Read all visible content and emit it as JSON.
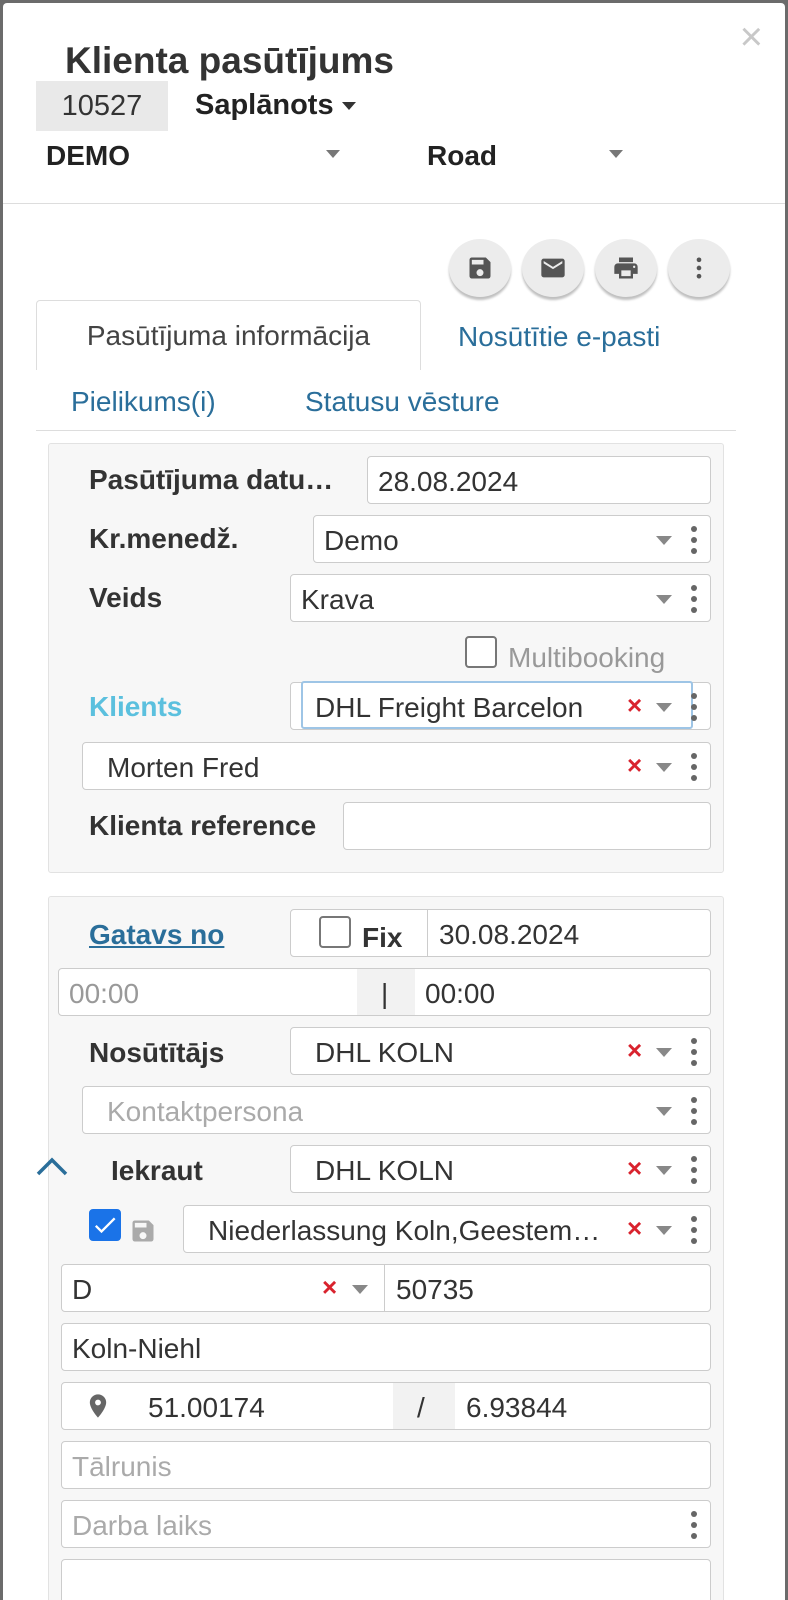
{
  "header": {
    "title": "Klienta pasūtījums",
    "order_number": "10527",
    "status": "Saplānots",
    "company": "DEMO",
    "transport": "Road"
  },
  "toolbar": {
    "save": "save-icon",
    "email": "envelope-icon",
    "print": "printer-icon",
    "more": "more-vertical-icon"
  },
  "tabs": [
    {
      "label": "Pasūtījuma informācija",
      "active": true
    },
    {
      "label": "Nosūtītie e-pasti",
      "active": false
    },
    {
      "label": "Pielikums(i)",
      "active": false
    },
    {
      "label": "Statusu vēsture",
      "active": false
    }
  ],
  "order_info": {
    "order_date_label": "Pasūtījuma datu…",
    "order_date": "28.08.2024",
    "manager_label": "Kr.menedž.",
    "manager": "Demo",
    "type_label": "Veids",
    "type": "Krava",
    "multibooking_label": "Multibooking",
    "client_label": "Klients",
    "client": "DHL Freight Barcelon",
    "contact": "Morten Fred",
    "client_ref_label": "Klienta reference",
    "client_ref": ""
  },
  "loading": {
    "ready_label": "Gatavs no",
    "fix_label": "Fix",
    "ready_date": "30.08.2024",
    "time_from": "00:00",
    "time_sep": "|",
    "time_to": "00:00",
    "shipper_label": "Nosūtītājs",
    "shipper": "DHL KOLN",
    "contact_placeholder": "Kontaktpersona",
    "load_label": "Iekraut",
    "load": "DHL KOLN",
    "address": "Niederlassung Koln,Geestem…",
    "country": "D",
    "postcode": "50735",
    "city": "Koln-Niehl",
    "lat": "51.00174",
    "coord_sep": "/",
    "lon": "6.93844",
    "phone_placeholder": "Tālrunis",
    "hours_placeholder": "Darba laiks"
  },
  "colors": {
    "link": "#2a6e9a",
    "client_label": "#5bc0de",
    "clear_x": "#d9232e",
    "checkbox": "#1a73e8"
  }
}
